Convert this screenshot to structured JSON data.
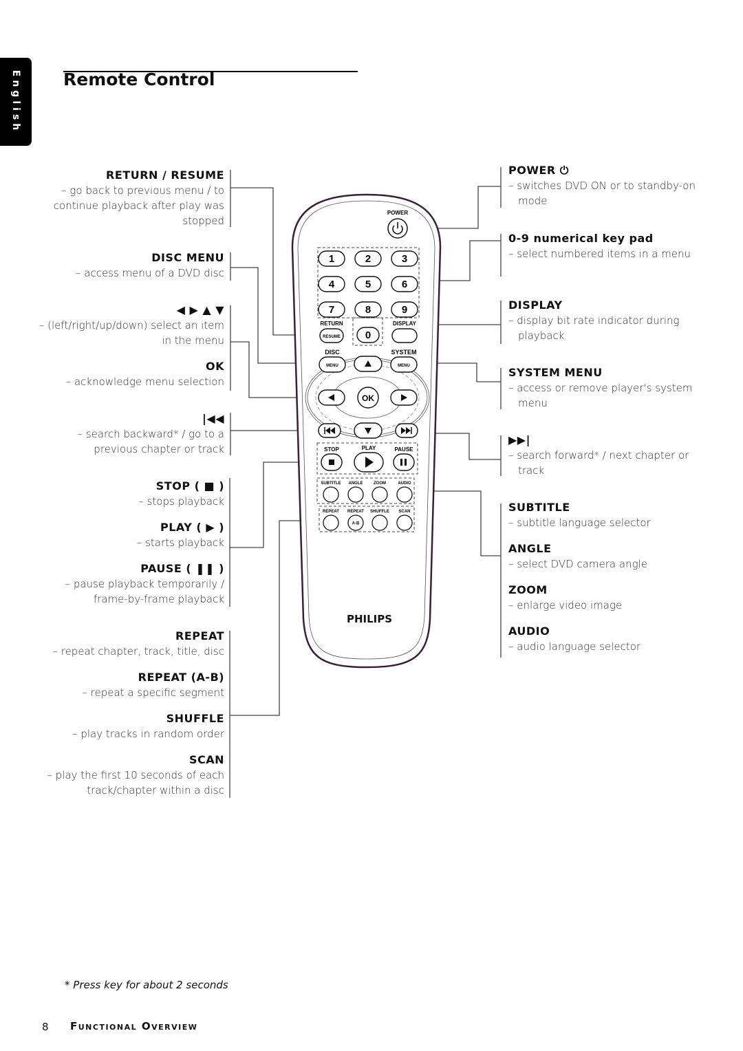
{
  "side_tab": "English",
  "page_title": "Remote Control",
  "left_labels": [
    {
      "heading": "RETURN / RESUME",
      "desc": "– go back to previous menu / to continue playback after play was stopped"
    },
    {
      "heading": "DISC MENU",
      "desc": "– access menu of a DVD disc"
    },
    {
      "heading": "◀ ▶ ▲ ▼",
      "desc": "– (left/right/up/down) select an item in the menu"
    },
    {
      "heading": "OK",
      "desc": "– acknowledge menu selection"
    },
    {
      "heading": "|◀◀",
      "desc": "– search backward* / go to a previous chapter or track"
    },
    {
      "heading": "STOP ( ■ )",
      "desc": "– stops playback"
    },
    {
      "heading": "PLAY ( ▶ )",
      "desc": "– starts playback"
    },
    {
      "heading": "PAUSE ( ❚❚ )",
      "desc": "– pause playback temporarily / frame-by-frame playback"
    },
    {
      "heading": "REPEAT",
      "desc": "– repeat chapter, track, title, disc"
    },
    {
      "heading": "REPEAT (A-B)",
      "desc": "– repeat a specific segment"
    },
    {
      "heading": "SHUFFLE",
      "desc": "– play tracks in random order"
    },
    {
      "heading": "SCAN",
      "desc": "– play the first 10 seconds of each track/chapter within a disc"
    }
  ],
  "right_labels": [
    {
      "heading": "POWER ⏻",
      "desc": "– switches DVD ON or to standby-on mode"
    },
    {
      "heading": "0-9 numerical key pad",
      "desc": "– select numbered items in a menu"
    },
    {
      "heading": "DISPLAY",
      "desc": "– display bit rate indicator during playback"
    },
    {
      "heading": "SYSTEM MENU",
      "desc": "– access or remove player's system menu"
    },
    {
      "heading": "▶▶|",
      "desc": "– search forward* / next chapter or track"
    },
    {
      "heading": "SUBTITLE",
      "desc": "– subtitle language selector"
    },
    {
      "heading": "ANGLE",
      "desc": "– select DVD camera angle"
    },
    {
      "heading": "ZOOM",
      "desc": "– enlarge video image"
    },
    {
      "heading": "AUDIO",
      "desc": "– audio language selector"
    }
  ],
  "remote": {
    "power_label": "POWER",
    "digits": [
      "1",
      "2",
      "3",
      "4",
      "5",
      "6",
      "7",
      "8",
      "9",
      "0"
    ],
    "return_label": "RETURN",
    "resume_label": "RESUME",
    "display_label": "DISPLAY",
    "disc_label": "DISC",
    "system_label": "SYSTEM",
    "menu_label": "MENU",
    "ok_label": "OK",
    "stop_label": "STOP",
    "play_label": "PLAY",
    "pause_label": "PAUSE",
    "row1_labels": [
      "SUBTITLE",
      "ANGLE",
      "ZOOM",
      "AUDIO"
    ],
    "row2_labels": [
      "REPEAT",
      "REPEAT",
      "SHUFFLE",
      "SCAN"
    ],
    "ab_label": "A-B",
    "brand": "PHILIPS"
  },
  "footnote": "* Press key for about 2 seconds",
  "footer": {
    "page_number": "8",
    "section": "Functional Overview"
  }
}
